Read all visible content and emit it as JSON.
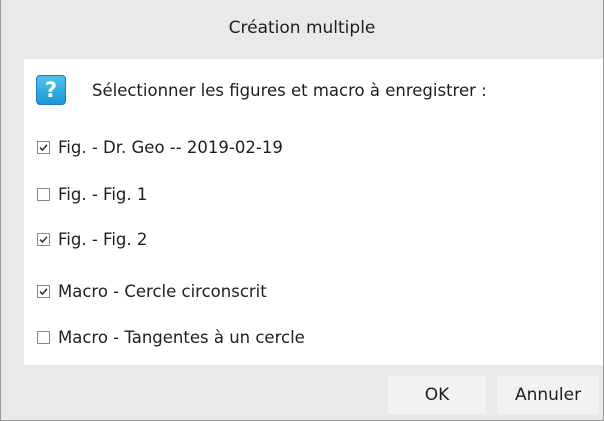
{
  "dialog": {
    "title": "Création multiple",
    "prompt": "Sélectionner les figures et macro à enregistrer :",
    "icon": "question-icon",
    "items": [
      {
        "label": "Fig. - Dr. Geo --  2019-02-19",
        "checked": true
      },
      {
        "label": "Fig. - Fig. 1",
        "checked": false
      },
      {
        "label": "Fig. - Fig. 2",
        "checked": true
      },
      {
        "label": "Macro - Cercle circonscrit",
        "checked": true
      },
      {
        "label": "Macro - Tangentes à un cercle",
        "checked": false
      }
    ],
    "ok_label": "OK",
    "cancel_label": "Annuler"
  },
  "colors": {
    "dialog_bg": "#e9e9e9",
    "content_bg": "#ffffff",
    "accent": "#2aa3e0"
  }
}
